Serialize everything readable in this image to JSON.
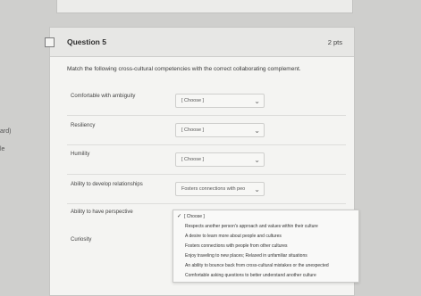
{
  "left_edge": [
    "ard)",
    "le"
  ],
  "question": {
    "title": "Question 5",
    "points": "2 pts",
    "instructions": "Match the following cross-cultural competencies with the correct collaborating complement."
  },
  "rows": [
    {
      "label": "Comfortable with ambiguity",
      "selected": "[ Choose ]"
    },
    {
      "label": "Resiliency",
      "selected": "[ Choose ]"
    },
    {
      "label": "Humility",
      "selected": "[ Choose ]"
    },
    {
      "label": "Ability to develop relationships",
      "selected": "Fosters connections with peo"
    },
    {
      "label": "Ability to have perspective",
      "selected": "[ Choose ]"
    },
    {
      "label": "Curiosity",
      "selected": ""
    }
  ],
  "dropdown": {
    "options": [
      "[ Choose ]",
      "Respects another person's approach and values within their culture",
      "A desire to learn more about people and cultures",
      "Fosters connections with people from other cultures",
      "Enjoy traveling to new places; Relaxed in unfamiliar situations",
      "An ability to bounce back from cross-cultural mistakes or the unexpected",
      "Comfortable asking questions to better understand another culture"
    ]
  }
}
